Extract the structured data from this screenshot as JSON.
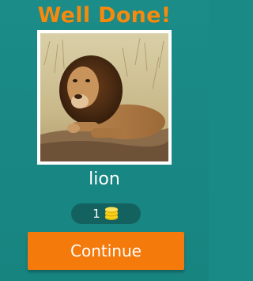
{
  "header": {
    "title": "Well Done!"
  },
  "question": {
    "image_icon": "lion-photo",
    "answer": "lion"
  },
  "reward": {
    "coins": "1",
    "icon": "coin-stack-icon"
  },
  "actions": {
    "continue_label": "Continue"
  },
  "colors": {
    "background": "#1a8a86",
    "title": "#f58a0f",
    "button": "#f57a0c",
    "pill": "#13625f",
    "coin": "#f7d117"
  }
}
